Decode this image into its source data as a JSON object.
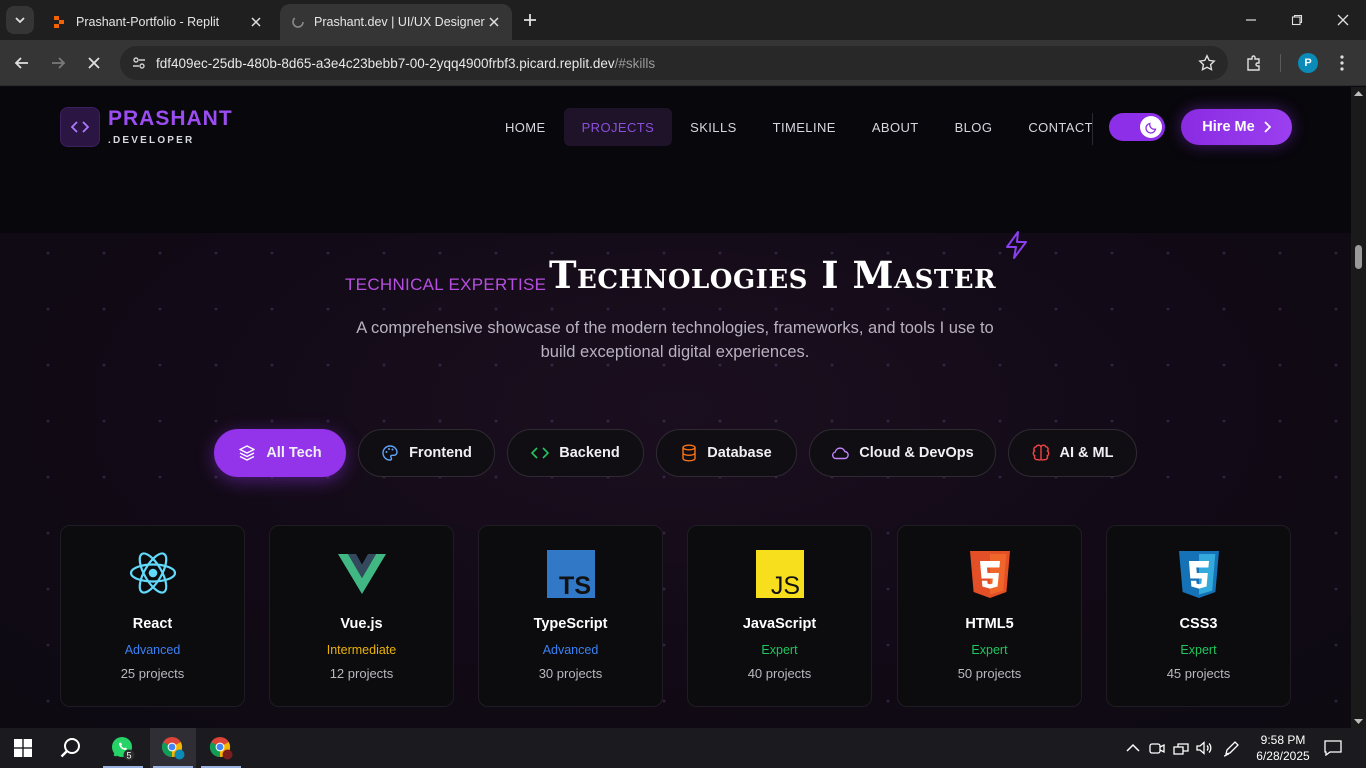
{
  "browser": {
    "tabs": [
      {
        "title": "Prashant-Portfolio - Replit",
        "active": false
      },
      {
        "title": "Prashant.dev | UI/UX Designer &",
        "active": true
      }
    ],
    "url_host": "fdf409ec-25db-480b-8d65-a3e4c23bebb7-00-2yqq4900frbf3.picard.replit.dev",
    "url_path": "/#skills",
    "profile_initial": "P"
  },
  "site": {
    "logo_name": "PRASHANT",
    "logo_sub": ".DEVELOPER",
    "nav": [
      "HOME",
      "PROJECTS",
      "SKILLS",
      "TIMELINE",
      "ABOUT",
      "BLOG",
      "CONTACT"
    ],
    "nav_active": "PROJECTS",
    "hire_label": "Hire Me"
  },
  "section": {
    "eyebrow": "TECHNICAL EXPERTISE",
    "heading": "Technologies I Master",
    "subtitle": "A comprehensive showcase of the modern technologies, frameworks, and tools I use to build exceptional digital experiences."
  },
  "filters": [
    {
      "label": "All Tech",
      "icon": "layers-icon",
      "active": true
    },
    {
      "label": "Frontend",
      "icon": "palette-icon",
      "active": false
    },
    {
      "label": "Backend",
      "icon": "code-icon",
      "active": false
    },
    {
      "label": "Database",
      "icon": "database-icon",
      "active": false
    },
    {
      "label": "Cloud & DevOps",
      "icon": "cloud-icon",
      "active": false
    },
    {
      "label": "AI & ML",
      "icon": "brain-icon",
      "active": false
    }
  ],
  "technologies": [
    {
      "name": "React",
      "level": "Advanced",
      "projects": "25 projects",
      "level_color": "#3b82f6",
      "icon": "react-icon"
    },
    {
      "name": "Vue.js",
      "level": "Intermediate",
      "projects": "12 projects",
      "level_color": "#eab308",
      "icon": "vue-icon"
    },
    {
      "name": "TypeScript",
      "level": "Advanced",
      "projects": "30 projects",
      "level_color": "#3b82f6",
      "icon": "typescript-icon"
    },
    {
      "name": "JavaScript",
      "level": "Expert",
      "projects": "40 projects",
      "level_color": "#22c55e",
      "icon": "javascript-icon"
    },
    {
      "name": "HTML5",
      "level": "Expert",
      "projects": "50 projects",
      "level_color": "#22c55e",
      "icon": "html5-icon"
    },
    {
      "name": "CSS3",
      "level": "Expert",
      "projects": "45 projects",
      "level_color": "#22c55e",
      "icon": "css3-icon"
    }
  ],
  "icon_text": {
    "ts": "TS",
    "js": "JS"
  },
  "taskbar": {
    "time": "9:58 PM",
    "date": "6/28/2025",
    "whatsapp_badge": "5"
  },
  "colors": {
    "accent": "#9333ea",
    "logo": "#9b4df2",
    "eyebrow": "#b64fe0"
  }
}
